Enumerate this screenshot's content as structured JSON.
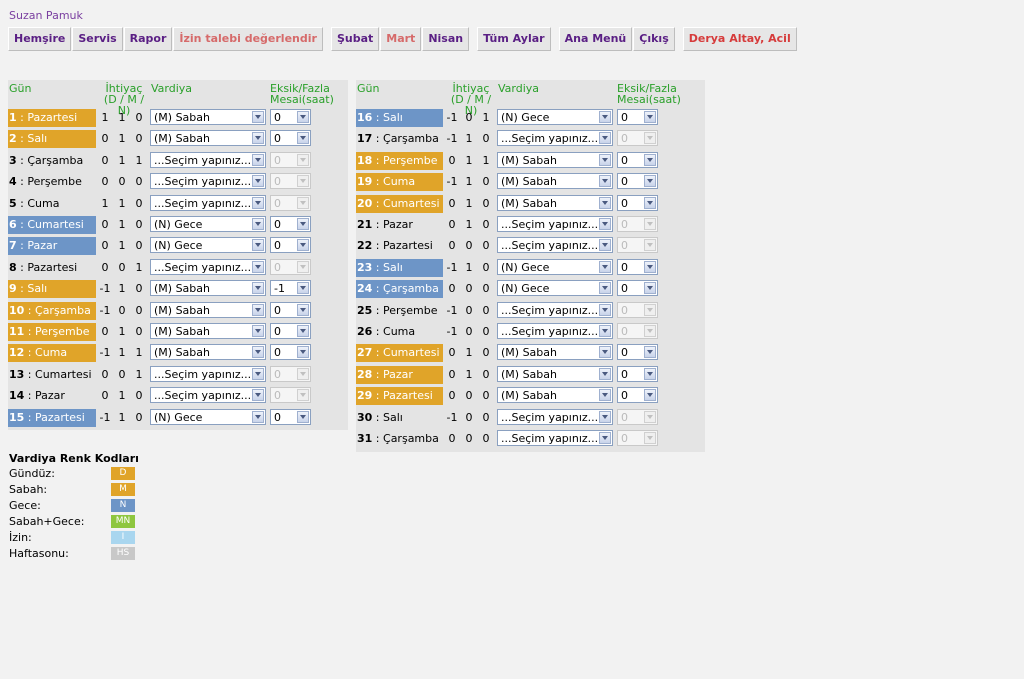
{
  "user_name": "Suzan Pamuk",
  "nav": [
    {
      "label": "Hemşire",
      "style": ""
    },
    {
      "label": "Servis",
      "style": ""
    },
    {
      "label": "Rapor",
      "style": ""
    },
    {
      "label": "İzin talebi değerlendir",
      "style": "dim"
    },
    {
      "label": "Şubat",
      "style": "gap"
    },
    {
      "label": "Mart",
      "style": "dim"
    },
    {
      "label": "Nisan",
      "style": ""
    },
    {
      "label": "Tüm Aylar",
      "style": "gap"
    },
    {
      "label": "Ana Menü",
      "style": "gap"
    },
    {
      "label": "Çıkış",
      "style": ""
    },
    {
      "label": "Derya Altay, Acil",
      "style": "red gap"
    }
  ],
  "headers": {
    "gun": "Gün",
    "ihtiyac": "İhtiyaç",
    "ihtiyac_sub": "(D / M / N)",
    "vardiya": "Vardiya",
    "eksik": "Eksik/Fazla",
    "mesai": "Mesai(saat)"
  },
  "left_days": [
    {
      "num": "1",
      "name": "Pazartesi",
      "color": "y",
      "d": "1",
      "m": "1",
      "n": "0",
      "shift": "(M) Sabah",
      "overtime": "0",
      "enabled": true
    },
    {
      "num": "2",
      "name": "Salı",
      "color": "y",
      "d": "0",
      "m": "1",
      "n": "0",
      "shift": "(M) Sabah",
      "overtime": "0",
      "enabled": true
    },
    {
      "num": "3",
      "name": "Çarşamba",
      "color": "pl",
      "d": "0",
      "m": "1",
      "n": "1",
      "shift": "...Seçim yapınız...",
      "overtime": "0",
      "enabled": false
    },
    {
      "num": "4",
      "name": "Perşembe",
      "color": "pl",
      "d": "0",
      "m": "0",
      "n": "0",
      "shift": "...Seçim yapınız...",
      "overtime": "0",
      "enabled": false
    },
    {
      "num": "5",
      "name": "Cuma",
      "color": "pl",
      "d": "1",
      "m": "1",
      "n": "0",
      "shift": "...Seçim yapınız...",
      "overtime": "0",
      "enabled": false
    },
    {
      "num": "6",
      "name": "Cumartesi",
      "color": "bl",
      "d": "0",
      "m": "1",
      "n": "0",
      "shift": "(N) Gece",
      "overtime": "0",
      "enabled": true
    },
    {
      "num": "7",
      "name": "Pazar",
      "color": "bl",
      "d": "0",
      "m": "1",
      "n": "0",
      "shift": "(N) Gece",
      "overtime": "0",
      "enabled": true
    },
    {
      "num": "8",
      "name": "Pazartesi",
      "color": "pl",
      "d": "0",
      "m": "0",
      "n": "1",
      "shift": "...Seçim yapınız...",
      "overtime": "0",
      "enabled": false
    },
    {
      "num": "9",
      "name": "Salı",
      "color": "y",
      "d": "-1",
      "m": "1",
      "n": "0",
      "shift": "(M) Sabah",
      "overtime": "-1",
      "enabled": true
    },
    {
      "num": "10",
      "name": "Çarşamba",
      "color": "y",
      "d": "-1",
      "m": "0",
      "n": "0",
      "shift": "(M) Sabah",
      "overtime": "0",
      "enabled": true
    },
    {
      "num": "11",
      "name": "Perşembe",
      "color": "y",
      "d": "0",
      "m": "1",
      "n": "0",
      "shift": "(M) Sabah",
      "overtime": "0",
      "enabled": true
    },
    {
      "num": "12",
      "name": "Cuma",
      "color": "y",
      "d": "-1",
      "m": "1",
      "n": "1",
      "shift": "(M) Sabah",
      "overtime": "0",
      "enabled": true
    },
    {
      "num": "13",
      "name": "Cumartesi",
      "color": "pl",
      "d": "0",
      "m": "0",
      "n": "1",
      "shift": "...Seçim yapınız...",
      "overtime": "0",
      "enabled": false
    },
    {
      "num": "14",
      "name": "Pazar",
      "color": "pl",
      "d": "0",
      "m": "1",
      "n": "0",
      "shift": "...Seçim yapınız...",
      "overtime": "0",
      "enabled": false
    },
    {
      "num": "15",
      "name": "Pazartesi",
      "color": "bl",
      "d": "-1",
      "m": "1",
      "n": "0",
      "shift": "(N) Gece",
      "overtime": "0",
      "enabled": true
    }
  ],
  "right_days": [
    {
      "num": "16",
      "name": "Salı",
      "color": "bl",
      "d": "-1",
      "m": "0",
      "n": "1",
      "shift": "(N) Gece",
      "overtime": "0",
      "enabled": true
    },
    {
      "num": "17",
      "name": "Çarşamba",
      "color": "pl",
      "d": "-1",
      "m": "1",
      "n": "0",
      "shift": "...Seçim yapınız...",
      "overtime": "0",
      "enabled": false
    },
    {
      "num": "18",
      "name": "Perşembe",
      "color": "y",
      "d": "0",
      "m": "1",
      "n": "1",
      "shift": "(M) Sabah",
      "overtime": "0",
      "enabled": true
    },
    {
      "num": "19",
      "name": "Cuma",
      "color": "y",
      "d": "-1",
      "m": "1",
      "n": "0",
      "shift": "(M) Sabah",
      "overtime": "0",
      "enabled": true
    },
    {
      "num": "20",
      "name": "Cumartesi",
      "color": "y",
      "d": "0",
      "m": "1",
      "n": "0",
      "shift": "(M) Sabah",
      "overtime": "0",
      "enabled": true
    },
    {
      "num": "21",
      "name": "Pazar",
      "color": "pl",
      "d": "0",
      "m": "1",
      "n": "0",
      "shift": "...Seçim yapınız...",
      "overtime": "0",
      "enabled": false
    },
    {
      "num": "22",
      "name": "Pazartesi",
      "color": "pl",
      "d": "0",
      "m": "0",
      "n": "0",
      "shift": "...Seçim yapınız...",
      "overtime": "0",
      "enabled": false
    },
    {
      "num": "23",
      "name": "Salı",
      "color": "bl",
      "d": "-1",
      "m": "1",
      "n": "0",
      "shift": "(N) Gece",
      "overtime": "0",
      "enabled": true
    },
    {
      "num": "24",
      "name": "Çarşamba",
      "color": "bl",
      "d": "0",
      "m": "0",
      "n": "0",
      "shift": "(N) Gece",
      "overtime": "0",
      "enabled": true
    },
    {
      "num": "25",
      "name": "Perşembe",
      "color": "pl",
      "d": "-1",
      "m": "0",
      "n": "0",
      "shift": "...Seçim yapınız...",
      "overtime": "0",
      "enabled": false
    },
    {
      "num": "26",
      "name": "Cuma",
      "color": "pl",
      "d": "-1",
      "m": "0",
      "n": "0",
      "shift": "...Seçim yapınız...",
      "overtime": "0",
      "enabled": false
    },
    {
      "num": "27",
      "name": "Cumartesi",
      "color": "y",
      "d": "0",
      "m": "1",
      "n": "0",
      "shift": "(M) Sabah",
      "overtime": "0",
      "enabled": true
    },
    {
      "num": "28",
      "name": "Pazar",
      "color": "y",
      "d": "0",
      "m": "1",
      "n": "0",
      "shift": "(M) Sabah",
      "overtime": "0",
      "enabled": true
    },
    {
      "num": "29",
      "name": "Pazartesi",
      "color": "y",
      "d": "0",
      "m": "0",
      "n": "0",
      "shift": "(M) Sabah",
      "overtime": "0",
      "enabled": true
    },
    {
      "num": "30",
      "name": "Salı",
      "color": "pl",
      "d": "-1",
      "m": "0",
      "n": "0",
      "shift": "...Seçim yapınız...",
      "overtime": "0",
      "enabled": false
    },
    {
      "num": "31",
      "name": "Çarşamba",
      "color": "pl",
      "d": "0",
      "m": "0",
      "n": "0",
      "shift": "...Seçim yapınız...",
      "overtime": "0",
      "enabled": false
    }
  ],
  "legend": {
    "title": "Vardiya Renk Kodları",
    "items": [
      {
        "label": "Gündüz:",
        "code": "D",
        "color": "#e0a429"
      },
      {
        "label": "Sabah:",
        "code": "M",
        "color": "#e0a429"
      },
      {
        "label": "Gece:",
        "code": "N",
        "color": "#6d95c7"
      },
      {
        "label": "Sabah+Gece:",
        "code": "MN",
        "color": "#8ec63f"
      },
      {
        "label": "İzin:",
        "code": "I",
        "color": "#a9d6ef"
      },
      {
        "label": "Haftasonu:",
        "code": "HS",
        "color": "#c8c8c8"
      }
    ]
  },
  "colors": {
    "yellow": "#e0a429",
    "blue": "#6d95c7",
    "header_green": "#2aa02a",
    "nav_purple": "#5a1f84",
    "nav_red": "#d63b3b"
  }
}
